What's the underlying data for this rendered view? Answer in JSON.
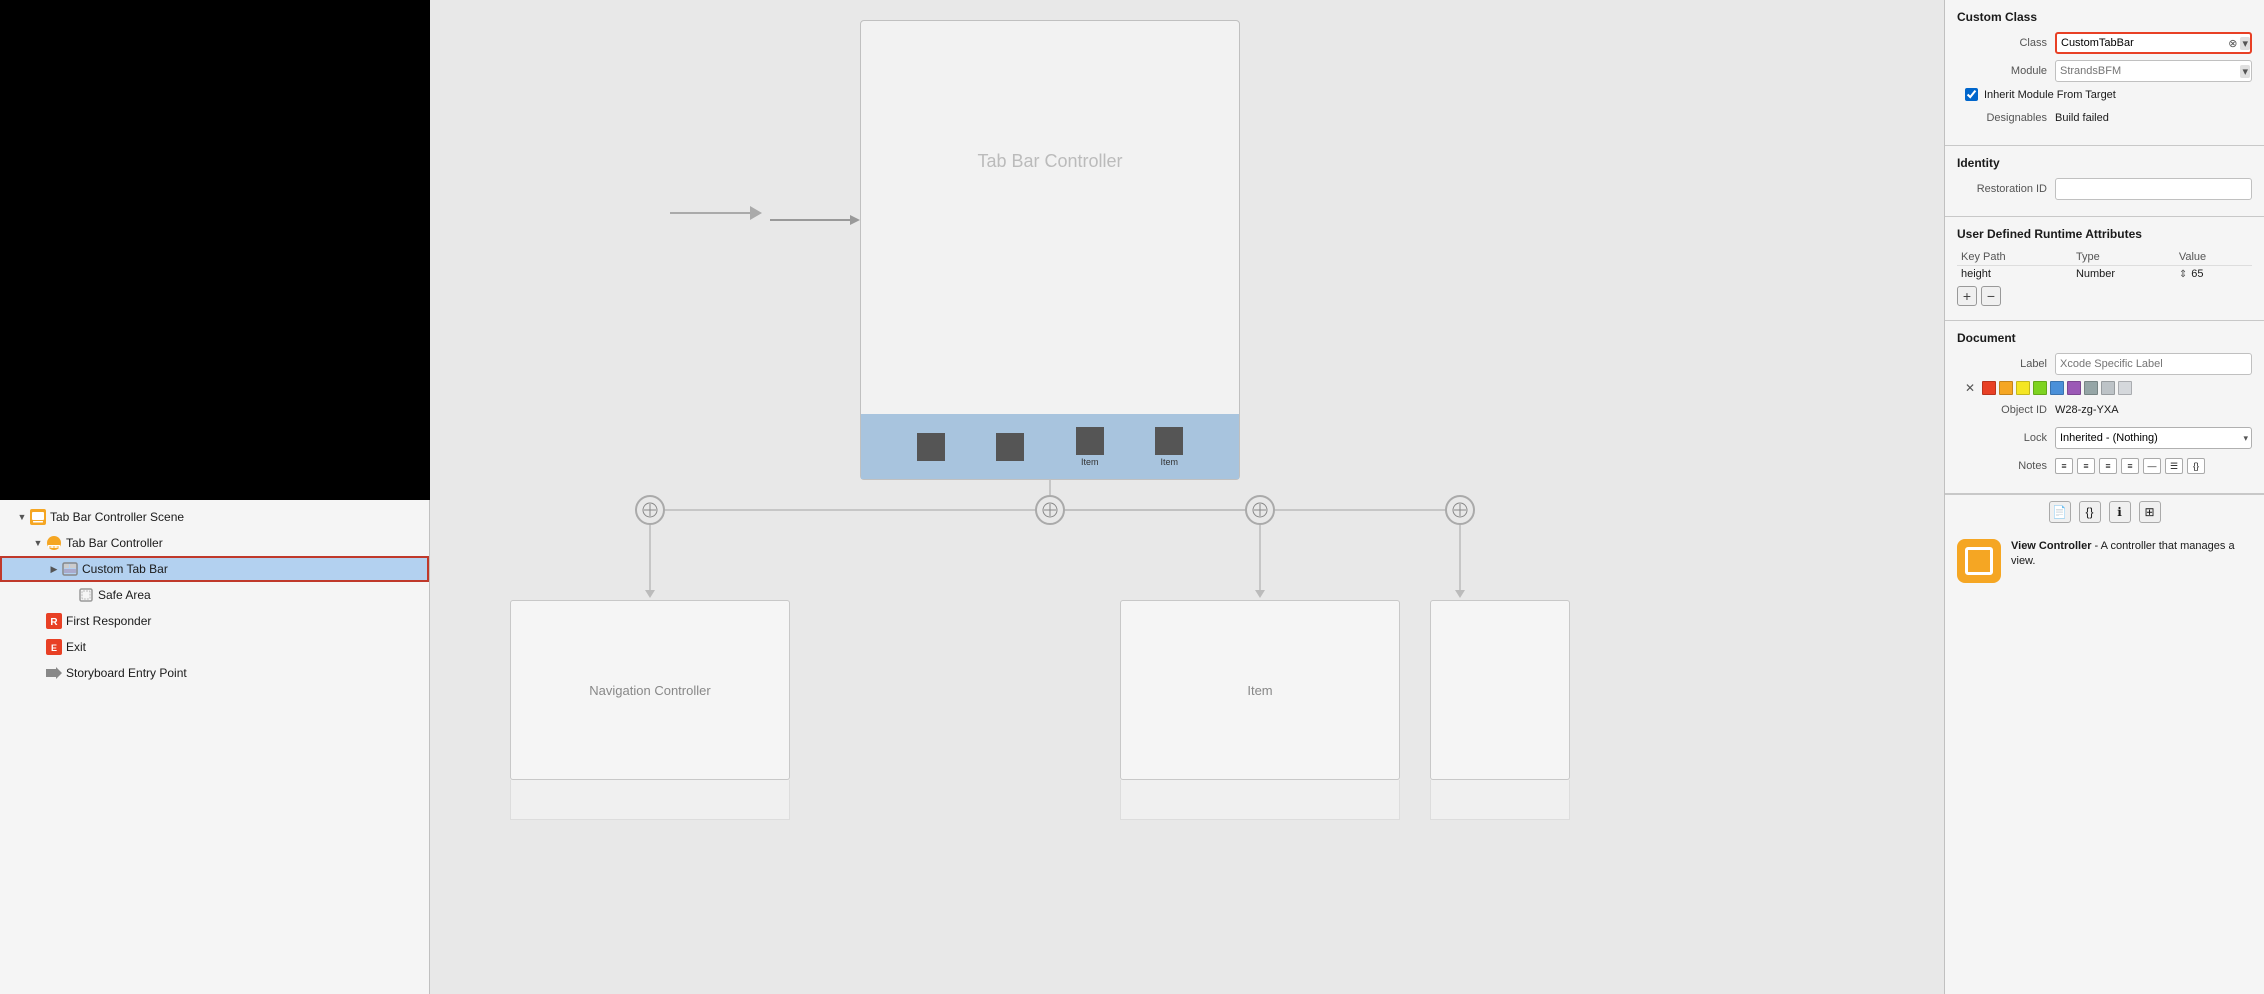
{
  "leftPanel": {
    "canvasPreview": "black_canvas",
    "outlineItems": [
      {
        "id": "scene",
        "label": "Tab Bar Controller Scene",
        "indent": 0,
        "icon": "scene",
        "disclosure": "open"
      },
      {
        "id": "tabbar-controller",
        "label": "Tab Bar Controller",
        "indent": 1,
        "icon": "tabbar",
        "disclosure": "open"
      },
      {
        "id": "custom-tabbar",
        "label": "Custom Tab Bar",
        "indent": 2,
        "icon": "custom-tabbar",
        "disclosure": "closed",
        "selected": true
      },
      {
        "id": "safe-area",
        "label": "Safe Area",
        "indent": 3,
        "icon": "safe-area",
        "disclosure": "none"
      },
      {
        "id": "first-responder",
        "label": "First Responder",
        "indent": 1,
        "icon": "first-responder",
        "disclosure": "none"
      },
      {
        "id": "exit",
        "label": "Exit",
        "indent": 1,
        "icon": "exit",
        "disclosure": "none"
      },
      {
        "id": "entry-point",
        "label": "Storyboard Entry Point",
        "indent": 1,
        "icon": "entry-point",
        "disclosure": "none"
      }
    ]
  },
  "canvas": {
    "tabBarController": {
      "title": "Tab Bar Controller",
      "tabItems": [
        "",
        "",
        "Item",
        "Item"
      ]
    },
    "subControllers": [
      "Navigation Controller",
      "Item"
    ],
    "connectionCircles": 4
  },
  "rightPanel": {
    "customClass": {
      "sectionTitle": "Custom Class",
      "classLabel": "Class",
      "classValue": "CustomTabBar",
      "moduleLabel": "Module",
      "moduleValue": "StrandsBFM",
      "modulePlaceholder": "StrandsBFM",
      "inheritCheckboxLabel": "Inherit Module From Target",
      "designablesLabel": "Designables",
      "designablesValue": "Build failed"
    },
    "identity": {
      "sectionTitle": "Identity",
      "restorationIdLabel": "Restoration ID",
      "restorationIdValue": ""
    },
    "runtimeAttributes": {
      "sectionTitle": "User Defined Runtime Attributes",
      "columns": [
        "Key Path",
        "Type",
        "Value"
      ],
      "rows": [
        {
          "keyPath": "height",
          "type": "Number",
          "value": "65"
        }
      ]
    },
    "document": {
      "sectionTitle": "Document",
      "labelLabel": "Label",
      "labelPlaceholder": "Xcode Specific Label",
      "objectIdLabel": "Object ID",
      "objectIdValue": "W28-zg-YXA",
      "lockLabel": "Lock",
      "lockValue": "Inherited - (Nothing)",
      "notesLabel": "Notes"
    },
    "viewController": {
      "title": "View Controller",
      "description": "- A controller that manages a view."
    }
  }
}
